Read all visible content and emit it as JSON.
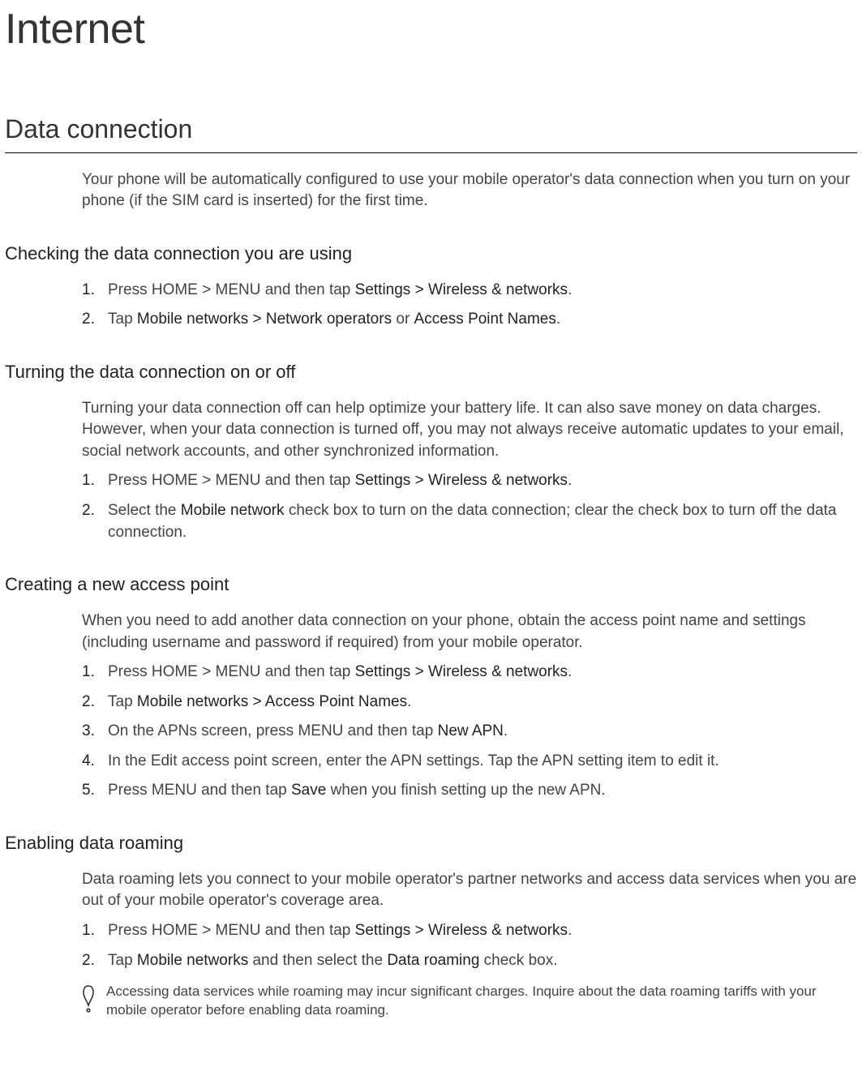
{
  "title": "Internet",
  "section": "Data connection",
  "intro": "Your phone will be automatically configured to use your mobile operator's data connection when you turn on your phone (if the SIM card is inserted) for the first time.",
  "checking": {
    "heading": "Checking the data connection you are using",
    "step1_pre": "Press HOME > MENU and then tap ",
    "step1_bold": "Settings > Wireless & networks",
    "step1_post": ".",
    "step2_pre": "Tap ",
    "step2_bold1": "Mobile networks > Network operators",
    "step2_mid": " or ",
    "step2_bold2": "Access Point Names",
    "step2_post": "."
  },
  "turning": {
    "heading": "Turning the data connection on or off",
    "para": "Turning your data connection off can help optimize your battery life. It can also save money on data charges. However, when your data connection is turned off, you may not always receive automatic updates to your email, social network accounts, and other synchronized information.",
    "step1_pre": "Press HOME > MENU and then tap ",
    "step1_bold": "Settings > Wireless & networks",
    "step1_post": ".",
    "step2_pre": "Select the ",
    "step2_bold": "Mobile network",
    "step2_post": " check box to turn on the data connection; clear the check box to turn off the data connection."
  },
  "creating": {
    "heading": "Creating a new access point",
    "para": "When you need to add another data connection on your phone, obtain the access point name and settings (including username and password if required) from your mobile operator.",
    "step1_pre": "Press HOME > MENU and then tap ",
    "step1_bold": "Settings > Wireless & networks",
    "step1_post": ".",
    "step2_pre": "Tap ",
    "step2_bold": "Mobile networks > Access Point Names",
    "step2_post": ".",
    "step3_pre": "On the APNs screen, press MENU and then tap ",
    "step3_bold": "New APN",
    "step3_post": ".",
    "step4": "In the Edit access point screen, enter the APN settings. Tap the APN setting item to edit it.",
    "step5_pre": "Press MENU and then tap ",
    "step5_bold": "Save",
    "step5_post": " when you finish setting up the new APN."
  },
  "roaming": {
    "heading": "Enabling data roaming",
    "para": "Data roaming lets you connect to your mobile operator's partner networks and access data services when you are out of your mobile operator's coverage area.",
    "step1_pre": "Press HOME > MENU and then tap ",
    "step1_bold": "Settings > Wireless & networks",
    "step1_post": ".",
    "step2_pre": "Tap ",
    "step2_bold1": "Mobile networks",
    "step2_mid": " and then select the ",
    "step2_bold2": "Data roaming",
    "step2_post": " check box.",
    "note": "Accessing data services while roaming may incur significant charges. Inquire about the data roaming tariffs with your mobile operator before enabling data roaming."
  },
  "numbers": {
    "n1": "1.",
    "n2": "2.",
    "n3": "3.",
    "n4": "4.",
    "n5": "5."
  }
}
